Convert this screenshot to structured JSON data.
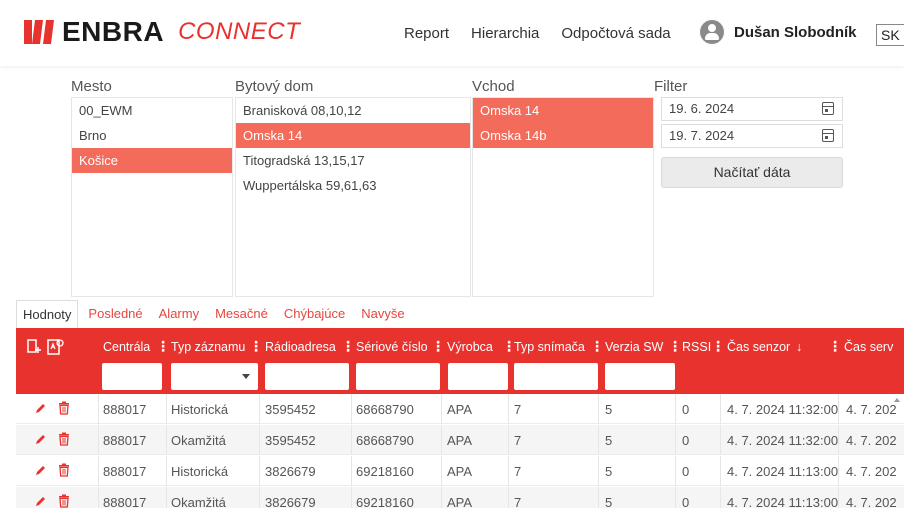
{
  "header": {
    "brand": "ENBRA",
    "product": "CONNECT",
    "nav": [
      "Report",
      "Hierarchia",
      "Odpočtová sada"
    ],
    "user_name": "Dušan Slobodník",
    "language": "SK",
    "brand_color": "#e8322e"
  },
  "selectors": {
    "mesto": {
      "title": "Mesto",
      "options": [
        "00_EWM",
        "Brno",
        "Košice"
      ],
      "selected": "Košice"
    },
    "bytovy_dom": {
      "title": "Bytový dom",
      "options": [
        "Branisková 08,10,12",
        "Omska 14",
        "Titogradská 13,15,17",
        "Wuppertálska 59,61,63"
      ],
      "selected": "Omska 14"
    },
    "vchod": {
      "title": "Vchod",
      "options": [
        "Omska 14",
        "Omska 14b"
      ],
      "selected": [
        "Omska 14",
        "Omska 14b"
      ]
    },
    "filter": {
      "title": "Filter",
      "date_from": "19. 6. 2024",
      "date_to": "19. 7. 2024",
      "load_label": "Načítať dáta"
    },
    "selection_color": "#f26b5b"
  },
  "tabs": {
    "items": [
      "Hodnoty",
      "Posledné",
      "Alarmy",
      "Mesačné",
      "Chýbajúce",
      "Navyše"
    ],
    "active": "Hodnoty"
  },
  "table": {
    "columns": [
      "Centrála",
      "Typ záznamu",
      "Rádioadresa",
      "Sériové číslo",
      "Výrobca",
      "Typ snímača",
      "Verzia SW",
      "RSSI",
      "Čas senzor",
      "Čas serv"
    ],
    "sort_indicator": "↓",
    "rows": [
      [
        "888017",
        "Historická",
        "3595452",
        "68668790",
        "APA",
        "7",
        "5",
        "0",
        "4. 7. 2024 11:32:00",
        "4. 7. 202"
      ],
      [
        "888017",
        "Okamžitá",
        "3595452",
        "68668790",
        "APA",
        "7",
        "5",
        "0",
        "4. 7. 2024 11:32:00",
        "4. 7. 202"
      ],
      [
        "888017",
        "Historická",
        "3826679",
        "69218160",
        "APA",
        "7",
        "5",
        "0",
        "4. 7. 2024 11:13:00",
        "4. 7. 202"
      ],
      [
        "888017",
        "Okamžitá",
        "3826679",
        "69218160",
        "APA",
        "7",
        "5",
        "0",
        "4. 7. 2024 11:13:00",
        "4. 7. 202"
      ]
    ]
  }
}
